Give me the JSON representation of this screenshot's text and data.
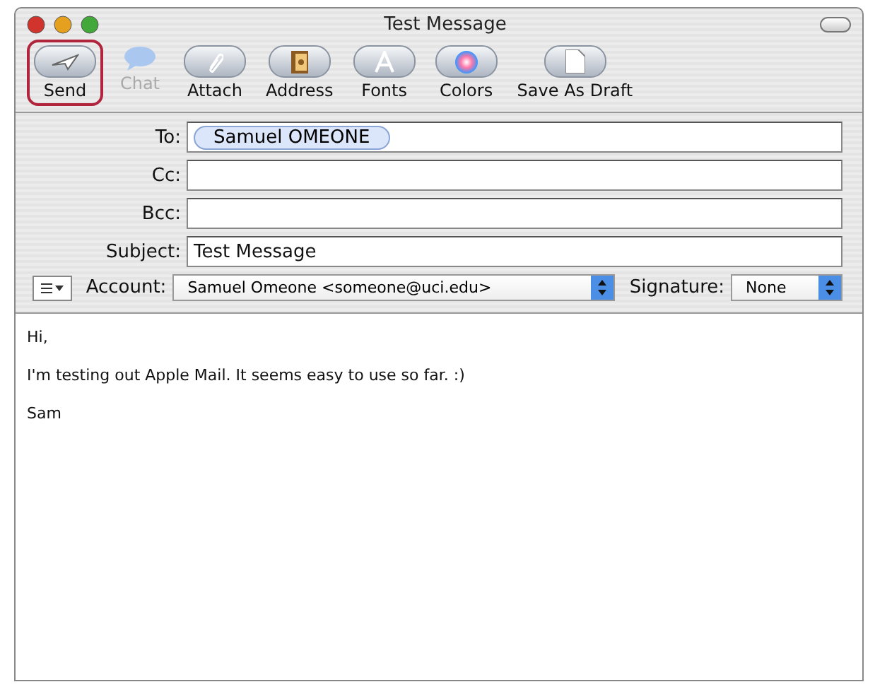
{
  "window": {
    "title": "Test Message"
  },
  "toolbar": [
    {
      "label": "Send",
      "kind": "send",
      "disabled": false,
      "selected": true
    },
    {
      "label": "Chat",
      "kind": "chat",
      "disabled": true,
      "selected": false
    },
    {
      "label": "Attach",
      "kind": "attach",
      "disabled": false,
      "selected": false
    },
    {
      "label": "Address",
      "kind": "address",
      "disabled": false,
      "selected": false
    },
    {
      "label": "Fonts",
      "kind": "fonts",
      "disabled": false,
      "selected": false
    },
    {
      "label": "Colors",
      "kind": "colors",
      "disabled": false,
      "selected": false
    },
    {
      "label": "Save As Draft",
      "kind": "draft",
      "disabled": false,
      "selected": false
    }
  ],
  "fields": [
    {
      "label": "To:",
      "tokens": [
        "Samuel OMEONE"
      ]
    },
    {
      "label": "Cc:"
    },
    {
      "label": "Bcc:"
    },
    {
      "label": "Subject:",
      "value": "Test Message"
    }
  ],
  "account": {
    "label": "Account:",
    "value": "Samuel Omeone <someone@uci.edu>"
  },
  "signature": {
    "label": "Signature:",
    "value": "None"
  },
  "body": [
    "Hi,",
    "I'm testing out Apple Mail. It seems easy to use so far. :)",
    "Sam"
  ]
}
